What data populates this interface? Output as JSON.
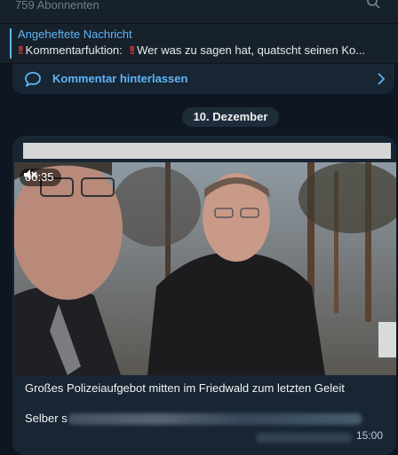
{
  "header": {
    "subscribers": "759 Abonnenten"
  },
  "pinned": {
    "title": "Angeheftete Nachricht",
    "text": "Kommentarfuktion:",
    "text2": "Wer was zu sagen hat, quatscht seinen Ko..."
  },
  "comments": {
    "label": "Kommentar hinterlassen"
  },
  "date": "10. Dezember",
  "post": {
    "video_duration": "00:35",
    "caption": "Großes Polizeiaufgebot mitten im Friedwald zum letzten Geleit",
    "second_line": "Selber s",
    "time": "15:00"
  },
  "colors": {
    "background": "#0e1621",
    "panel": "#17212b",
    "bubble": "#182533",
    "accent": "#5eb5f7",
    "exclamation": "#e0312f"
  }
}
